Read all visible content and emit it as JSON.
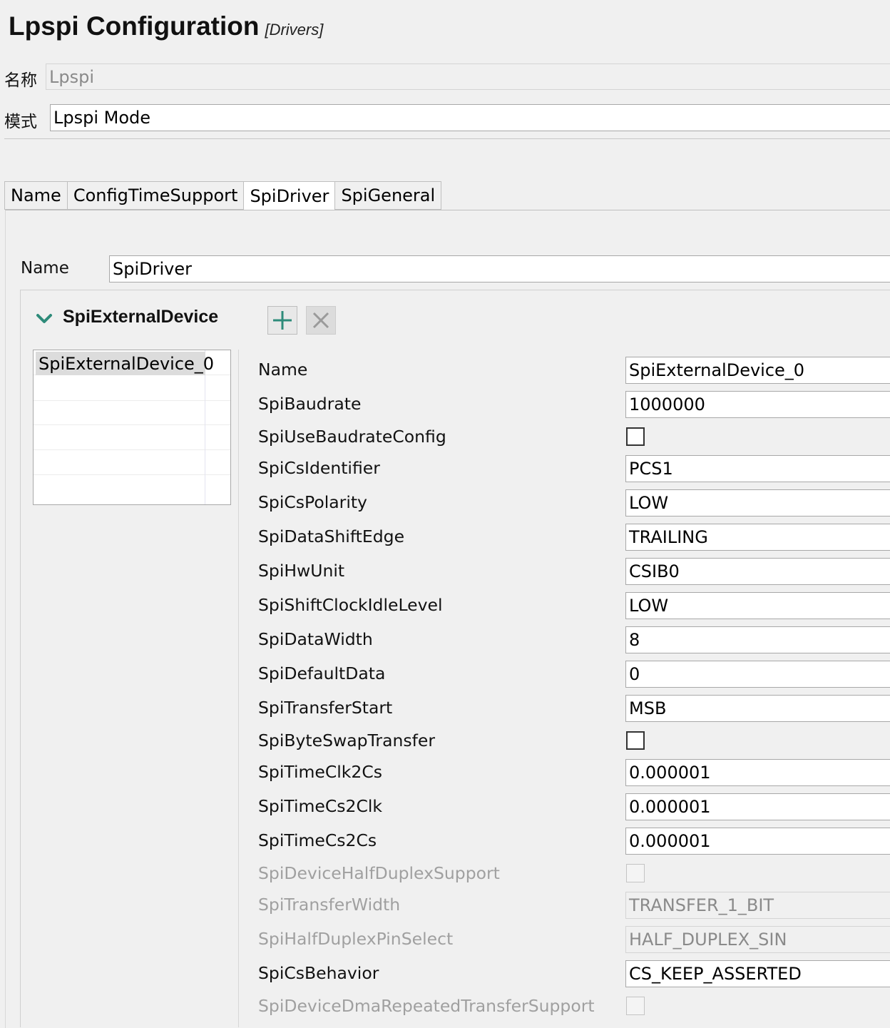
{
  "header": {
    "title": "Lpspi Configuration",
    "subtitle": "[Drivers]"
  },
  "top_fields": {
    "name_label": "名称",
    "name_value": "Lpspi",
    "mode_label": "模式",
    "mode_value": "Lpspi Mode"
  },
  "tabs": [
    {
      "label": "Name",
      "active": false
    },
    {
      "label": "ConfigTimeSupport",
      "active": false
    },
    {
      "label": "SpiDriver",
      "active": true
    },
    {
      "label": "SpiGeneral",
      "active": false
    }
  ],
  "panel": {
    "name_label": "Name",
    "name_value": "SpiDriver"
  },
  "section": {
    "title": "SpiExternalDevice",
    "add_icon": "plus-icon",
    "delete_icon": "close-icon",
    "expand_icon": "chevron-down-icon",
    "accent_color": "#2e8b7a",
    "list_items": [
      "SpiExternalDevice_0"
    ]
  },
  "props": [
    {
      "label": "Name",
      "type": "text",
      "value": "SpiExternalDevice_0",
      "enabled": true
    },
    {
      "label": "SpiBaudrate",
      "type": "text",
      "value": "1000000",
      "enabled": true
    },
    {
      "label": "SpiUseBaudrateConfig",
      "type": "checkbox",
      "checked": false,
      "enabled": true
    },
    {
      "label": "SpiCsIdentifier",
      "type": "text",
      "value": "PCS1",
      "enabled": true
    },
    {
      "label": "SpiCsPolarity",
      "type": "text",
      "value": "LOW",
      "enabled": true
    },
    {
      "label": "SpiDataShiftEdge",
      "type": "text",
      "value": "TRAILING",
      "enabled": true
    },
    {
      "label": "SpiHwUnit",
      "type": "text",
      "value": "CSIB0",
      "enabled": true
    },
    {
      "label": "SpiShiftClockIdleLevel",
      "type": "text",
      "value": "LOW",
      "enabled": true
    },
    {
      "label": "SpiDataWidth",
      "type": "text",
      "value": "8",
      "enabled": true
    },
    {
      "label": "SpiDefaultData",
      "type": "text",
      "value": "0",
      "enabled": true
    },
    {
      "label": "SpiTransferStart",
      "type": "text",
      "value": "MSB",
      "enabled": true
    },
    {
      "label": "SpiByteSwapTransfer",
      "type": "checkbox",
      "checked": false,
      "enabled": true
    },
    {
      "label": "SpiTimeClk2Cs",
      "type": "text",
      "value": "0.000001",
      "enabled": true
    },
    {
      "label": "SpiTimeCs2Clk",
      "type": "text",
      "value": "0.000001",
      "enabled": true
    },
    {
      "label": "SpiTimeCs2Cs",
      "type": "text",
      "value": "0.000001",
      "enabled": true
    },
    {
      "label": "SpiDeviceHalfDuplexSupport",
      "type": "checkbox",
      "checked": false,
      "enabled": false
    },
    {
      "label": "SpiTransferWidth",
      "type": "text",
      "value": "TRANSFER_1_BIT",
      "enabled": false
    },
    {
      "label": "SpiHalfDuplexPinSelect",
      "type": "text",
      "value": "HALF_DUPLEX_SIN",
      "enabled": false
    },
    {
      "label": "SpiCsBehavior",
      "type": "text",
      "value": "CS_KEEP_ASSERTED",
      "enabled": true
    },
    {
      "label": "SpiDeviceDmaRepeatedTransferSupport",
      "type": "checkbox",
      "checked": false,
      "enabled": false
    }
  ]
}
